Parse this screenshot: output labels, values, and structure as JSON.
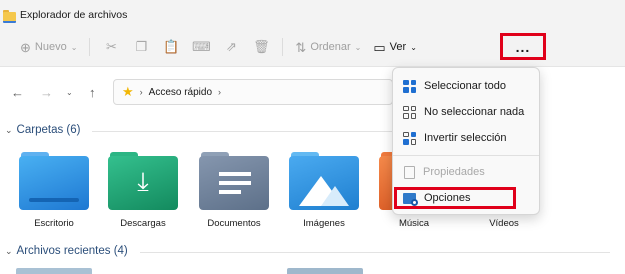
{
  "window": {
    "title": "Explorador de archivos"
  },
  "commandbar": {
    "new_label": "Nuevo",
    "sort_label": "Ordenar",
    "view_label": "Ver",
    "more_label": "...",
    "icons": [
      "cut-icon",
      "copy-icon",
      "paste-icon",
      "rename-icon",
      "share-icon",
      "delete-icon"
    ]
  },
  "address": {
    "location": "Acceso rápido"
  },
  "groups": {
    "folders": {
      "label": "Carpetas (6)"
    },
    "recent": {
      "label": "Archivos recientes (4)"
    }
  },
  "folders": [
    {
      "label": "Escritorio",
      "color": "#1e78d2"
    },
    {
      "label": "Descargas",
      "color": "#1a9a6a"
    },
    {
      "label": "Documentos",
      "color": "#6b7f99"
    },
    {
      "label": "Imágenes",
      "color": "#2a8fde"
    },
    {
      "label": "Música",
      "color": "#e0632e"
    },
    {
      "label": "Vídeos",
      "color": "#8a4fd6"
    }
  ],
  "menu": {
    "items": [
      {
        "label": "Seleccionar todo",
        "enabled": true
      },
      {
        "label": "No seleccionar nada",
        "enabled": true
      },
      {
        "label": "Invertir selección",
        "enabled": true
      },
      {
        "label": "Propiedades",
        "enabled": false
      },
      {
        "label": "Opciones",
        "enabled": true
      }
    ]
  },
  "colors": {
    "highlight": "#e0001a",
    "accent": "#0067c0"
  }
}
